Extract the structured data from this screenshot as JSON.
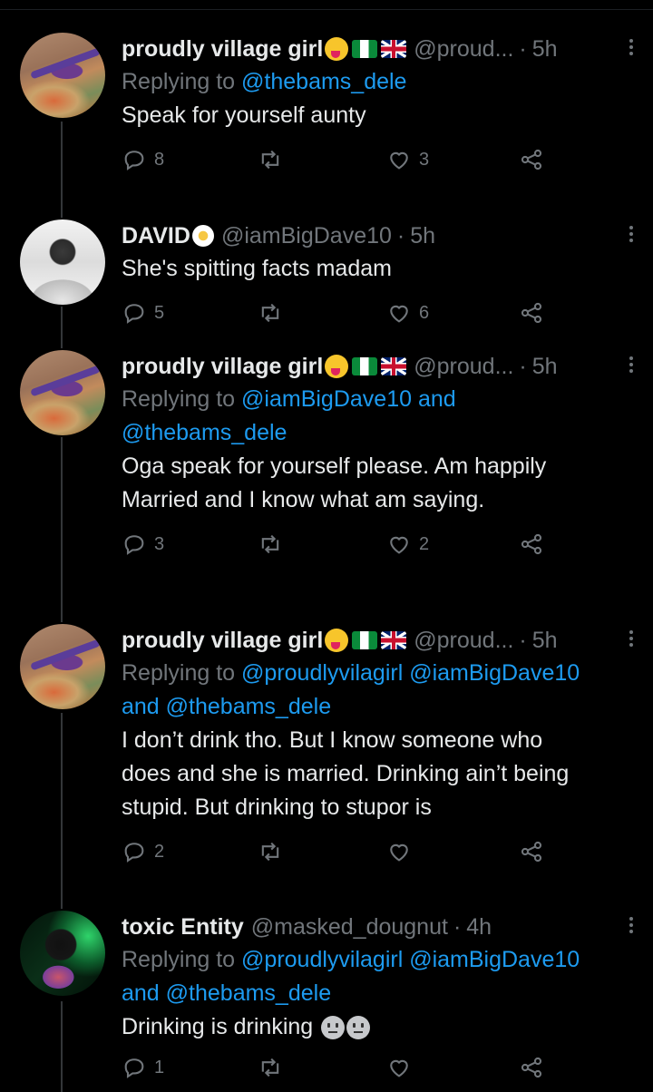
{
  "tweets": [
    {
      "name": "proudly village girl",
      "badges": [
        "face-with-tongue-emoji",
        "nigeria-flag",
        "uk-flag"
      ],
      "handle": "@proud...",
      "time": "5h",
      "replying_prefix": "Replying to",
      "replying_line1": "@thebams_dele",
      "replying_line2": "",
      "text_lines": [
        "Speak for yourself aunty"
      ],
      "replies": "8",
      "retweets": "",
      "likes": "3"
    },
    {
      "name": "DAVID",
      "badges": [
        "flower-emoji"
      ],
      "handle": "@iamBigDave10",
      "time": "5h",
      "text_lines": [
        "She's spitting facts madam"
      ],
      "replies": "5",
      "retweets": "",
      "likes": "6"
    },
    {
      "name": "proudly village girl",
      "badges": [
        "face-with-tongue-emoji",
        "nigeria-flag",
        "uk-flag"
      ],
      "handle": "@proud...",
      "time": "5h",
      "replying_prefix": "Replying to",
      "replying_line1": "@iamBigDave10 and",
      "replying_line2": "@thebams_dele",
      "text_lines": [
        "Oga speak for yourself please. Am happily",
        "Married and I know what am saying."
      ],
      "replies": "3",
      "retweets": "",
      "likes": "2"
    },
    {
      "name": "proudly village girl",
      "badges": [
        "face-with-tongue-emoji",
        "nigeria-flag",
        "uk-flag"
      ],
      "handle": "@proud...",
      "time": "5h",
      "replying_prefix": "Replying to",
      "replying_line1": "@proudlyvilagirl @iamBigDave10",
      "replying_line2": "and @thebams_dele",
      "text_lines": [
        "I don’t drink tho. But I know someone who",
        "does and she is married. Drinking ain’t being",
        "stupid. But drinking to stupor is"
      ],
      "replies": "2",
      "retweets": "",
      "likes": ""
    },
    {
      "name": "toxic Entity",
      "badges": [],
      "handle": "@masked_dougnut",
      "time": "4h",
      "replying_prefix": "Replying to",
      "replying_line1": "@proudlyvilagirl @iamBigDave10",
      "replying_line2": "and @thebams_dele",
      "text_lines": [
        "Drinking is drinking"
      ],
      "trailing_emoji": [
        "neutral-face-emoji",
        "neutral-face-emoji"
      ],
      "replies": "1",
      "retweets": "",
      "likes": ""
    }
  ],
  "colors": {
    "background": "#000000",
    "text": "#e7e9ea",
    "secondary": "#71767b",
    "mention": "#1d9bf0",
    "thread_line": "#333639"
  }
}
